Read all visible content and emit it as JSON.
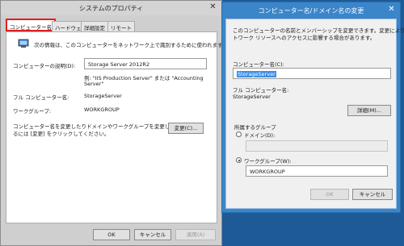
{
  "system_props": {
    "title": "システムのプロパティ",
    "close_glyph": "✕",
    "tabs": [
      "コンピューター名",
      "ハードウェア",
      "詳細設定",
      "リモート"
    ],
    "intro_text": "次の情報は、このコンピューターをネットワーク上で識別するために使われます。",
    "description_label": "コンピューターの説明(D):",
    "description_value": "Storage Server 2012R2",
    "example_line1": "例: \"IIS Production Server\" または \"Accounting",
    "example_line2": "Server\"",
    "full_name_label": "フル コンピューター名:",
    "full_name_value": "StorageServer",
    "workgroup_label": "ワークグループ:",
    "workgroup_value": "WORKGROUP",
    "rename_text_line1": "コンピューター名を変更したりドメインやワークグループを変更したりす",
    "rename_text_line2": "るには [変更] をクリックしてください。",
    "change_button": "変更(C)...",
    "ok_button": "OK",
    "cancel_button": "キャンセル",
    "apply_button": "適用(A)"
  },
  "rename_dialog": {
    "title": "コンピューター名/ドメイン名の変更",
    "close_glyph": "✕",
    "intro_line1": "このコンピューターの名前とメンバーシップを変更できます。変更により、ネッ",
    "intro_line2": "トワーク リソースへのアクセスに影響する場合があります。",
    "computer_name_label": "コンピューター名(C):",
    "computer_name_value": "StorageServer",
    "full_name_label": "フル コンピューター名:",
    "full_name_value": "StorageServer",
    "details_button": "詳細(M)...",
    "member_of_label": "所属するグループ",
    "domain_label": "ドメイン(D):",
    "domain_value": "",
    "workgroup_label": "ワークグループ(W):",
    "workgroup_value": "WORKGROUP",
    "membership_selected": "workgroup",
    "ok_button": "OK",
    "cancel_button": "キャンセル"
  },
  "colors": {
    "desktop": "#1e5a96",
    "dialog_frame": "#3b85c9",
    "tab_highlight": "#e02020",
    "text_selection": "#3a8ee6"
  }
}
